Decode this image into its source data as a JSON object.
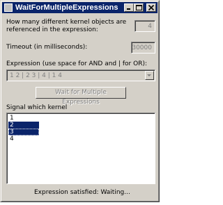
{
  "window": {
    "title": "WaitForMultipleExpressions"
  },
  "kernel_objects": {
    "label_line1": "How many different kernel objects are",
    "label_line2": "referenced in the expression:",
    "value": "4"
  },
  "timeout": {
    "label": "Timeout (in milliseconds):",
    "value": "30000"
  },
  "expression": {
    "label": "Expression (use space for AND and | for OR):",
    "value": "1 2 | 2 3 | 4 | 1 4"
  },
  "wait_button": {
    "label": "Wait for Multiple Expressions"
  },
  "signal_list": {
    "label": "Signal which kernel",
    "items": [
      {
        "text": "1",
        "selected": false
      },
      {
        "text": "2",
        "selected": true
      },
      {
        "text": "3",
        "selected": true
      },
      {
        "text": "4",
        "selected": false
      }
    ]
  },
  "status": {
    "text": "Expression satisfied:  Waiting..."
  }
}
